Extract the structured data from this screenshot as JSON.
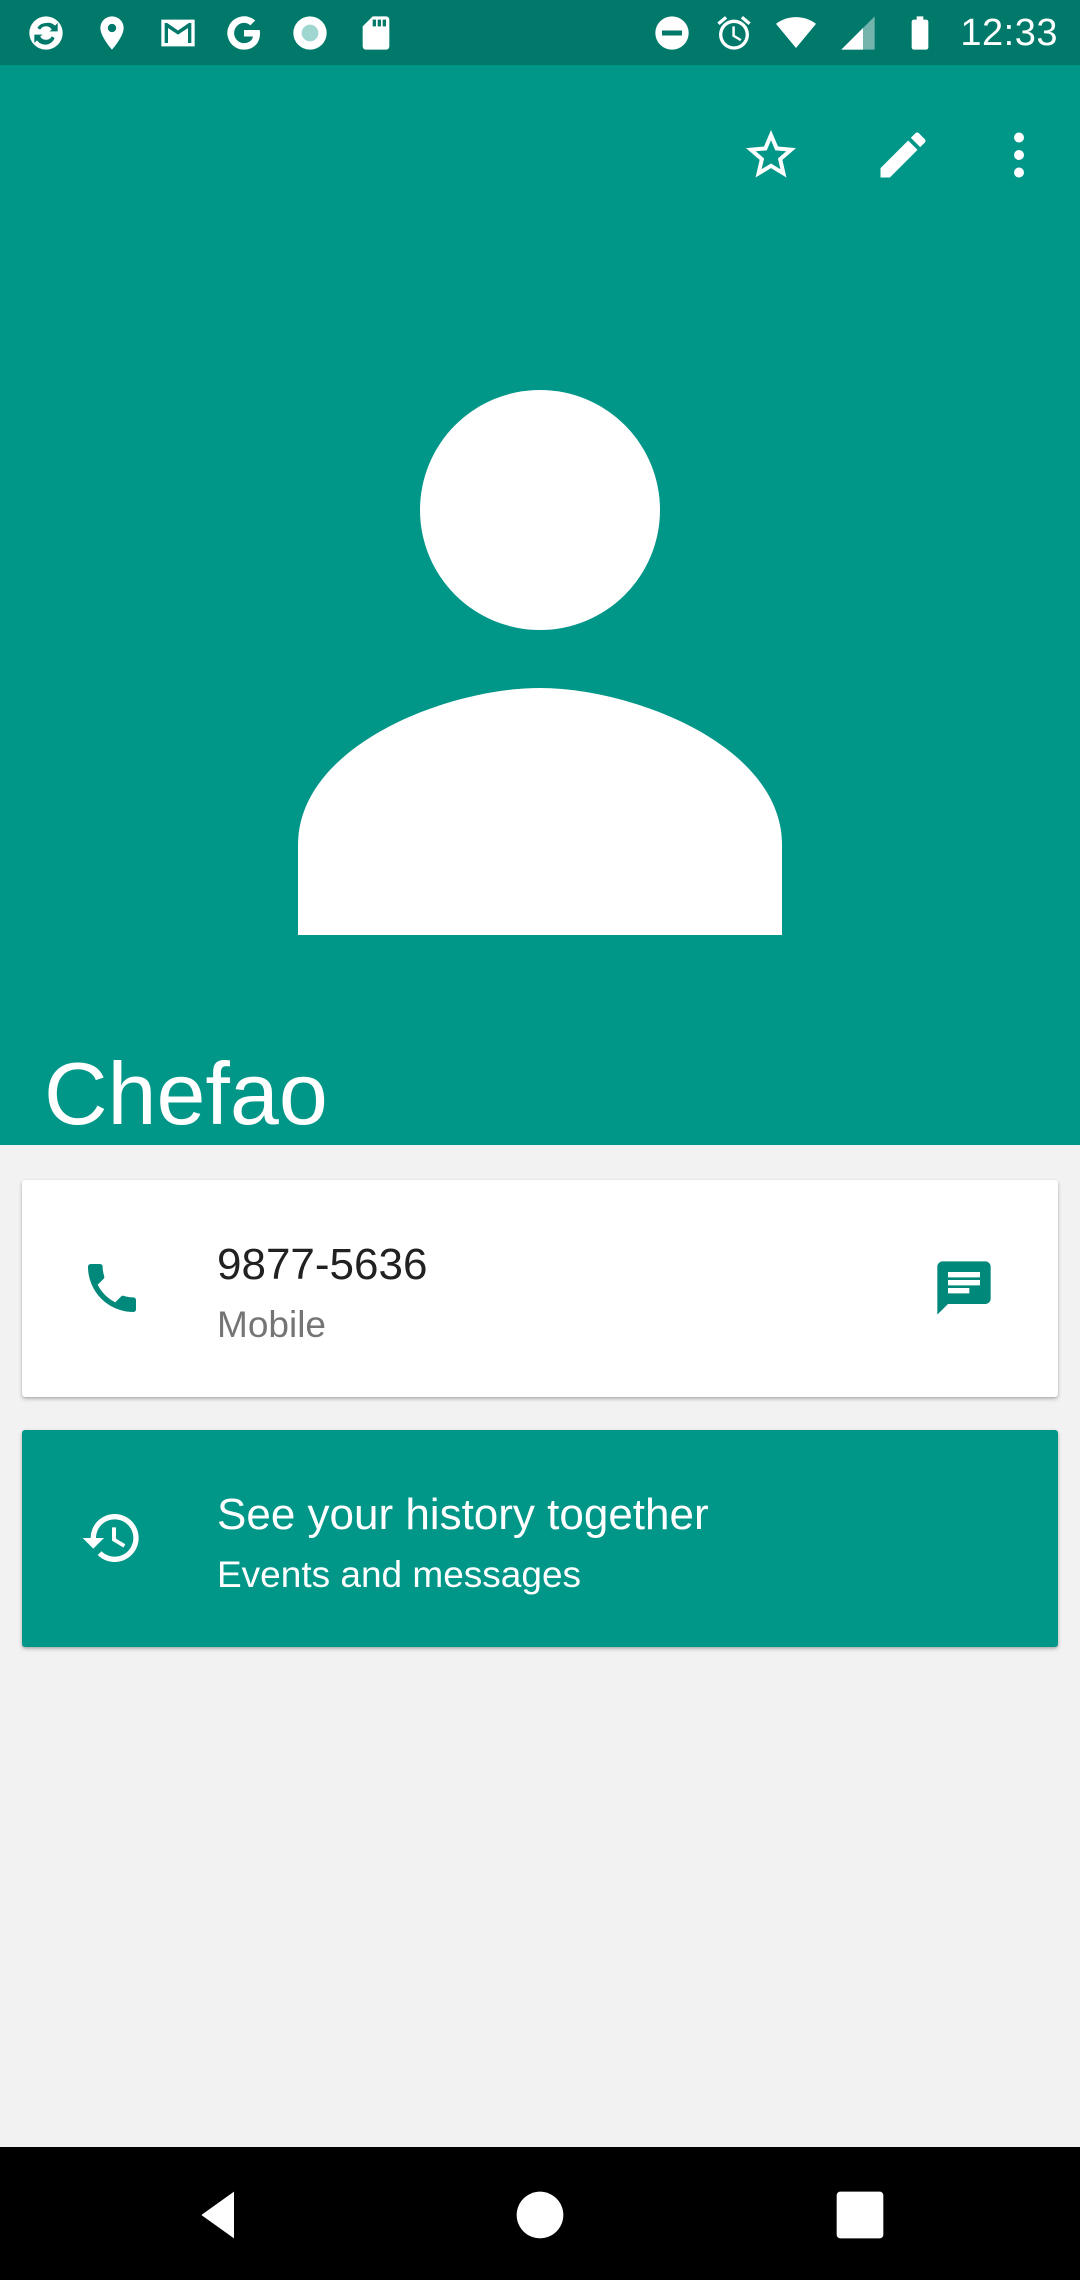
{
  "status_bar": {
    "time": "12:33",
    "left_icons": [
      "sync-icon",
      "location-icon",
      "gmail-icon",
      "google-icon",
      "radio-icon",
      "sd-card-icon"
    ],
    "right_icons": [
      "do-not-disturb-icon",
      "alarm-icon",
      "wifi-icon",
      "signal-icon",
      "battery-icon"
    ]
  },
  "toolbar": {
    "actions": [
      "star-icon",
      "edit-icon",
      "more-vert-icon"
    ]
  },
  "contact": {
    "name": "Chefao",
    "phone_number": "9877-5636",
    "phone_type": "Mobile"
  },
  "history": {
    "title": "See your history together",
    "subtitle": "Events and messages"
  },
  "colors": {
    "status_bar": "#00796b",
    "primary": "#009688",
    "accent_icon": "#00897b",
    "background": "#f2f2f2"
  },
  "navigation": {
    "buttons": [
      "back-icon",
      "home-icon",
      "recents-icon"
    ]
  }
}
